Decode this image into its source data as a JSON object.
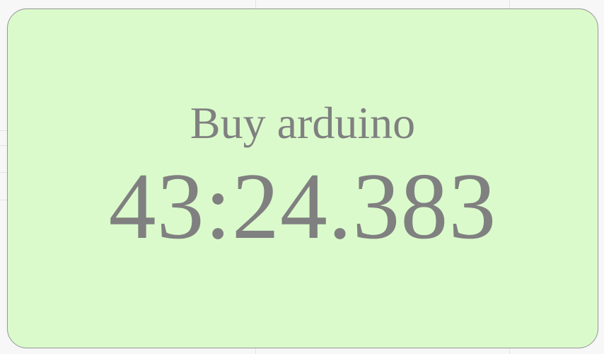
{
  "timer": {
    "task_name": "Buy arduino",
    "elapsed": "43:24.383"
  },
  "colors": {
    "card_background": "#dafacb",
    "card_border": "#9a9a9a",
    "text": "#808080",
    "page_background": "#f7f7f7"
  }
}
